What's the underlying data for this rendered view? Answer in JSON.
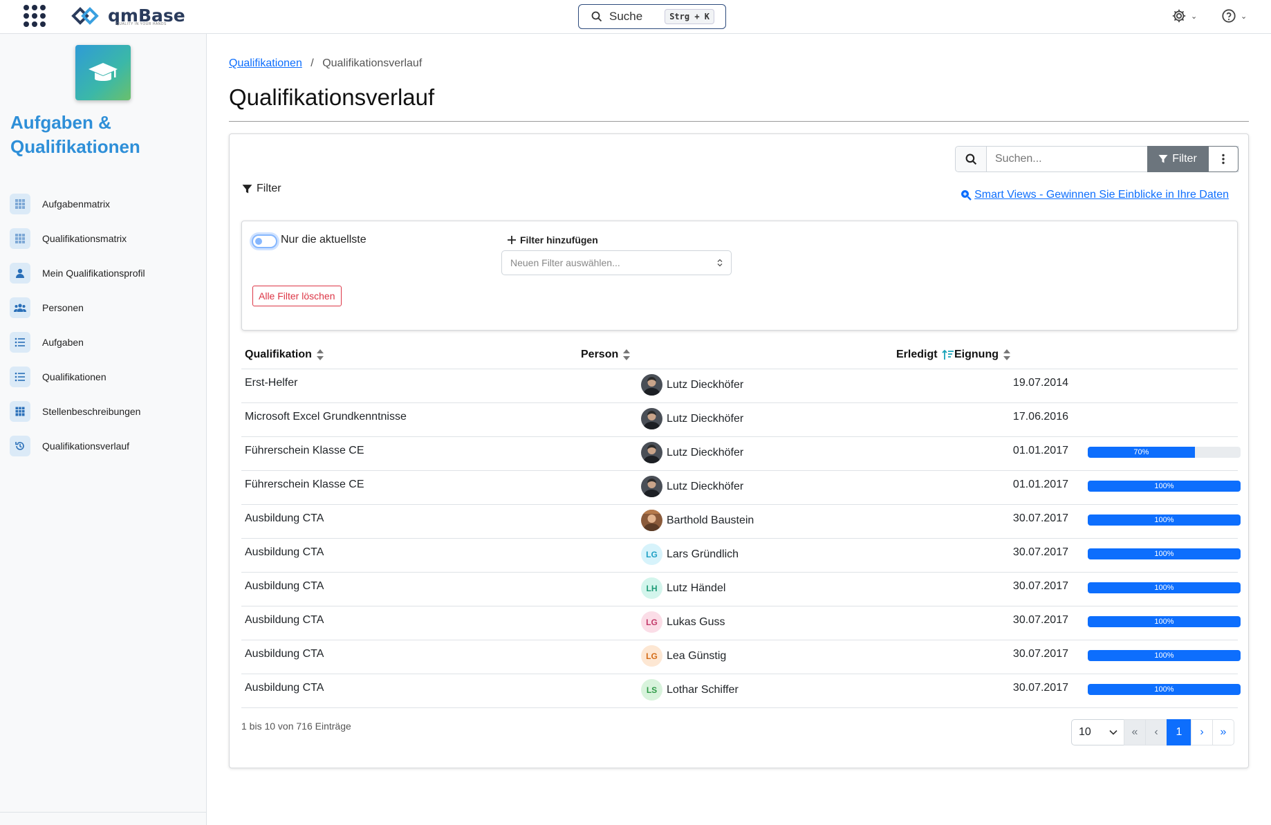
{
  "header": {
    "logo_text": "qmBase",
    "logo_tagline": "QUALITY IN YOUR HANDS",
    "search_label": "Suche",
    "search_shortcut": "Strg + K"
  },
  "sidebar": {
    "app_title_line1": "Aufgaben &",
    "app_title_line2": "Qualifikationen",
    "items": [
      {
        "label": "Aufgabenmatrix",
        "icon": "grid-icon"
      },
      {
        "label": "Qualifikationsmatrix",
        "icon": "grid-icon"
      },
      {
        "label": "Mein Qualifikationsprofil",
        "icon": "user-icon"
      },
      {
        "label": "Personen",
        "icon": "users-icon"
      },
      {
        "label": "Aufgaben",
        "icon": "list-icon"
      },
      {
        "label": "Qualifikationen",
        "icon": "list-icon"
      },
      {
        "label": "Stellenbeschreibungen",
        "icon": "table-icon"
      },
      {
        "label": "Qualifikationsverlauf",
        "icon": "history-icon"
      }
    ]
  },
  "breadcrumb": {
    "parent": "Qualifikationen",
    "current": "Qualifikationsverlauf"
  },
  "page_title": "Qualifikationsverlauf",
  "toolbar": {
    "search_placeholder": "Suchen...",
    "filter_button": "Filter",
    "filter_label": "Filter",
    "smart_views_link": "Smart Views - Gewinnen Sie Einblicke in Ihre Daten"
  },
  "filter_panel": {
    "toggle_label": "Nur die aktuellste",
    "add_filter_label": "Filter hinzufügen",
    "select_placeholder": "Neuen Filter auswählen...",
    "clear_button": "Alle Filter löschen"
  },
  "table": {
    "columns": {
      "qualification": "Qualifikation",
      "person": "Person",
      "done": "Erledigt",
      "suitability": "Eignung"
    },
    "rows": [
      {
        "qualification": "Erst-Helfer",
        "person": "Lutz Dieckhöfer",
        "avatar_initials": "",
        "avatar_type": "photo-dark",
        "date": "19.07.2014",
        "progress": null,
        "progress_label": ""
      },
      {
        "qualification": "Microsoft Excel Grundkenntnisse",
        "person": "Lutz Dieckhöfer",
        "avatar_initials": "",
        "avatar_type": "photo-dark",
        "date": "17.06.2016",
        "progress": null,
        "progress_label": ""
      },
      {
        "qualification": "Führerschein Klasse CE",
        "person": "Lutz Dieckhöfer",
        "avatar_initials": "",
        "avatar_type": "photo-dark",
        "date": "01.01.2017",
        "progress": 70,
        "progress_label": "70%"
      },
      {
        "qualification": "Führerschein Klasse CE",
        "person": "Lutz Dieckhöfer",
        "avatar_initials": "",
        "avatar_type": "photo-dark",
        "date": "01.01.2017",
        "progress": 100,
        "progress_label": "100%"
      },
      {
        "qualification": "Ausbildung CTA",
        "person": "Barthold Baustein",
        "avatar_initials": "",
        "avatar_type": "photo-warm",
        "date": "30.07.2017",
        "progress": 100,
        "progress_label": "100%"
      },
      {
        "qualification": "Ausbildung CTA",
        "person": "Lars Gründlich",
        "avatar_initials": "LG",
        "avatar_type": "cyan",
        "date": "30.07.2017",
        "progress": 100,
        "progress_label": "100%"
      },
      {
        "qualification": "Ausbildung CTA",
        "person": "Lutz Händel",
        "avatar_initials": "LH",
        "avatar_type": "teal",
        "date": "30.07.2017",
        "progress": 100,
        "progress_label": "100%"
      },
      {
        "qualification": "Ausbildung CTA",
        "person": "Lukas Guss",
        "avatar_initials": "LG",
        "avatar_type": "pink",
        "date": "30.07.2017",
        "progress": 100,
        "progress_label": "100%"
      },
      {
        "qualification": "Ausbildung CTA",
        "person": "Lea Günstig",
        "avatar_initials": "LG",
        "avatar_type": "orange",
        "date": "30.07.2017",
        "progress": 100,
        "progress_label": "100%"
      },
      {
        "qualification": "Ausbildung CTA",
        "person": "Lothar Schiffer",
        "avatar_initials": "LS",
        "avatar_type": "green",
        "date": "30.07.2017",
        "progress": 100,
        "progress_label": "100%"
      }
    ]
  },
  "footer": {
    "entries_text": "1 bis 10 von 716 Einträge",
    "page_size": "10",
    "pager": {
      "first": "«",
      "prev": "‹",
      "current": "1",
      "next": "›",
      "last": "»"
    }
  },
  "colors": {
    "accent": "#0d6efd",
    "app_title": "#2e8fd8",
    "danger": "#dc3545",
    "sort_active": "#17a2b8"
  }
}
